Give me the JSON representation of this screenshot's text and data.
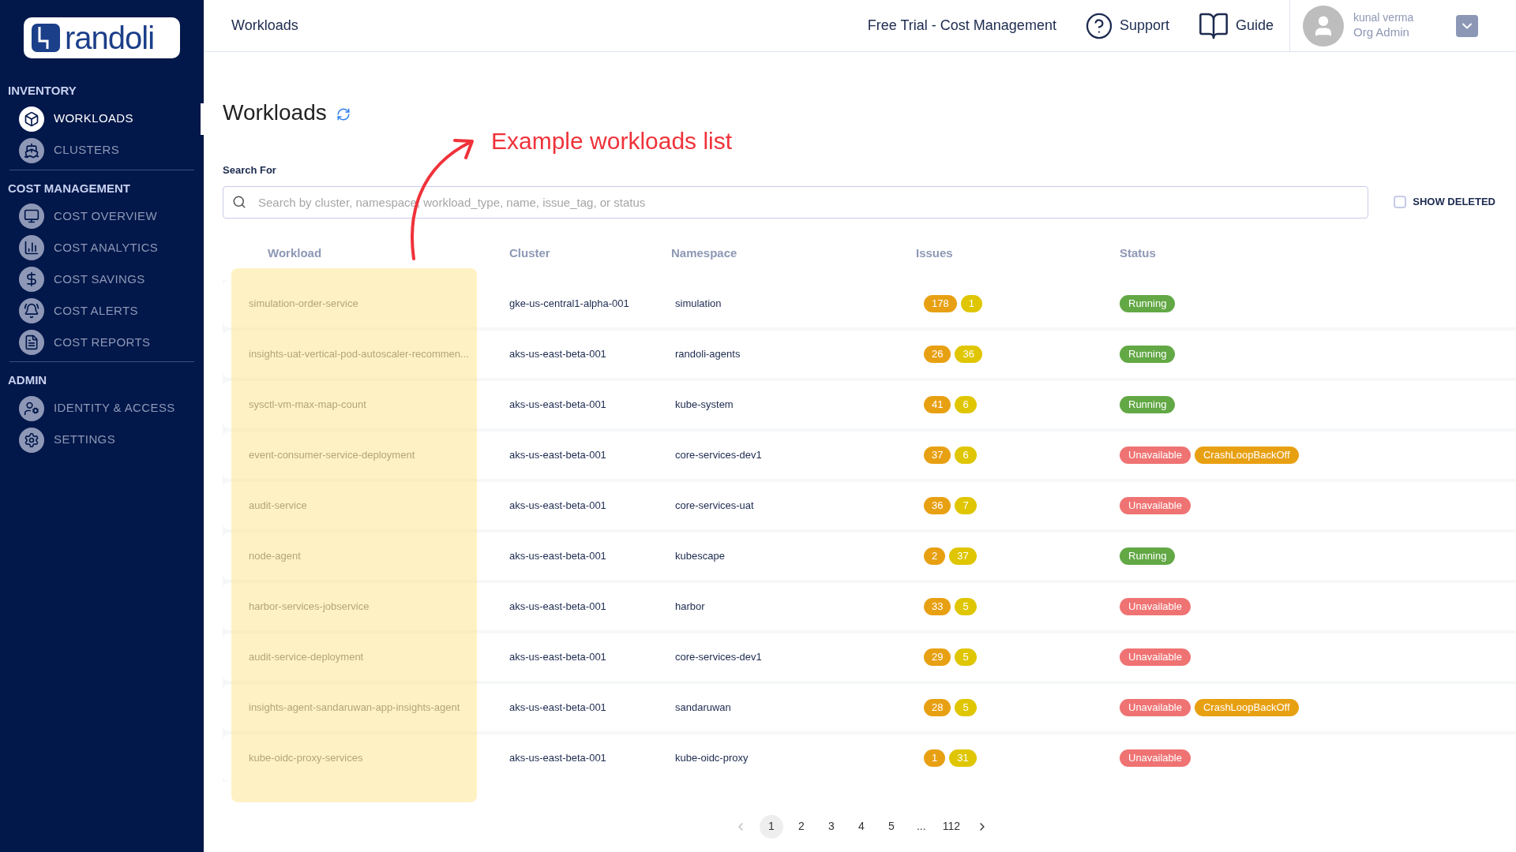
{
  "logo": {
    "text": "randoli"
  },
  "sidebar": {
    "sections": [
      {
        "title": "INVENTORY",
        "items": [
          {
            "label": "WORKLOADS",
            "kind": "cube",
            "selected": true
          },
          {
            "label": "CLUSTERS",
            "kind": "helm",
            "selected": false
          }
        ]
      },
      {
        "title": "COST MANAGEMENT",
        "items": [
          {
            "label": "COST OVERVIEW",
            "kind": "monitor",
            "selected": false
          },
          {
            "label": "COST ANALYTICS",
            "kind": "chart",
            "selected": false
          },
          {
            "label": "COST SAVINGS",
            "kind": "bag",
            "selected": false
          },
          {
            "label": "COST ALERTS",
            "kind": "bell",
            "selected": false
          },
          {
            "label": "COST REPORTS",
            "kind": "report",
            "selected": false
          }
        ]
      },
      {
        "title": "ADMIN",
        "items": [
          {
            "label": "IDENTITY & ACCESS",
            "kind": "user",
            "selected": false
          },
          {
            "label": "SETTINGS",
            "kind": "gear",
            "selected": false
          }
        ]
      }
    ]
  },
  "header": {
    "breadcrumb": "Workloads",
    "trial": "Free Trial - Cost Management",
    "support": "Support",
    "guide": "Guide",
    "user": {
      "name": "kunal verma",
      "role": "Org Admin"
    }
  },
  "page": {
    "title": "Workloads",
    "annotation": "Example workloads list",
    "search_label": "Search For",
    "search": {
      "placeholder": "Search by cluster, namespace, workload_type, name, issue_tag, or status"
    },
    "show_deleted": {
      "label": "SHOW DELETED",
      "checked": false
    }
  },
  "table": {
    "columns": [
      "Workload",
      "Cluster",
      "Namespace",
      "Issues",
      "Status"
    ],
    "rows": [
      {
        "workload": "simulation-order-service",
        "cluster": "gke-us-central1-alpha-001",
        "namespace": "simulation",
        "issues": [
          {
            "count": "178",
            "kind": "high"
          },
          {
            "count": "1",
            "kind": "medium"
          }
        ],
        "status": [
          {
            "label": "Running",
            "kind": "running"
          }
        ]
      },
      {
        "workload": "insights-uat-vertical-pod-autoscaler-recommen...",
        "cluster": "aks-us-east-beta-001",
        "namespace": "randoli-agents",
        "issues": [
          {
            "count": "26",
            "kind": "high"
          },
          {
            "count": "36",
            "kind": "medium"
          }
        ],
        "status": [
          {
            "label": "Running",
            "kind": "running"
          }
        ]
      },
      {
        "workload": "sysctl-vm-max-map-count",
        "cluster": "aks-us-east-beta-001",
        "namespace": "kube-system",
        "issues": [
          {
            "count": "41",
            "kind": "high"
          },
          {
            "count": "6",
            "kind": "medium"
          }
        ],
        "status": [
          {
            "label": "Running",
            "kind": "running"
          }
        ]
      },
      {
        "workload": "event-consumer-service-deployment",
        "cluster": "aks-us-east-beta-001",
        "namespace": "core-services-dev1",
        "issues": [
          {
            "count": "37",
            "kind": "high"
          },
          {
            "count": "6",
            "kind": "medium"
          }
        ],
        "status": [
          {
            "label": "Unavailable",
            "kind": "unavailable"
          },
          {
            "label": "CrashLoopBackOff",
            "kind": "warning"
          }
        ]
      },
      {
        "workload": "audit-service",
        "cluster": "aks-us-east-beta-001",
        "namespace": "core-services-uat",
        "issues": [
          {
            "count": "36",
            "kind": "high"
          },
          {
            "count": "7",
            "kind": "medium"
          }
        ],
        "status": [
          {
            "label": "Unavailable",
            "kind": "unavailable"
          }
        ]
      },
      {
        "workload": "node-agent",
        "cluster": "aks-us-east-beta-001",
        "namespace": "kubescape",
        "issues": [
          {
            "count": "2",
            "kind": "high"
          },
          {
            "count": "37",
            "kind": "medium"
          }
        ],
        "status": [
          {
            "label": "Running",
            "kind": "running"
          }
        ]
      },
      {
        "workload": "harbor-services-jobservice",
        "cluster": "aks-us-east-beta-001",
        "namespace": "harbor",
        "issues": [
          {
            "count": "33",
            "kind": "high"
          },
          {
            "count": "5",
            "kind": "medium"
          }
        ],
        "status": [
          {
            "label": "Unavailable",
            "kind": "unavailable"
          }
        ]
      },
      {
        "workload": "audit-service-deployment",
        "cluster": "aks-us-east-beta-001",
        "namespace": "core-services-dev1",
        "issues": [
          {
            "count": "29",
            "kind": "high"
          },
          {
            "count": "5",
            "kind": "medium"
          }
        ],
        "status": [
          {
            "label": "Unavailable",
            "kind": "unavailable"
          }
        ]
      },
      {
        "workload": "insights-agent-sandaruwan-app-insights-agent",
        "cluster": "aks-us-east-beta-001",
        "namespace": "sandaruwan",
        "issues": [
          {
            "count": "28",
            "kind": "high"
          },
          {
            "count": "5",
            "kind": "medium"
          }
        ],
        "status": [
          {
            "label": "Unavailable",
            "kind": "unavailable"
          },
          {
            "label": "CrashLoopBackOff",
            "kind": "warning"
          }
        ]
      },
      {
        "workload": "kube-oidc-proxy-services",
        "cluster": "aks-us-east-beta-001",
        "namespace": "kube-oidc-proxy",
        "issues": [
          {
            "count": "1",
            "kind": "high"
          },
          {
            "count": "31",
            "kind": "medium"
          }
        ],
        "status": [
          {
            "label": "Unavailable",
            "kind": "unavailable"
          }
        ]
      }
    ]
  },
  "pagination": {
    "pages": [
      {
        "label": "1",
        "selected": true
      },
      {
        "label": "2",
        "selected": false
      },
      {
        "label": "3",
        "selected": false
      },
      {
        "label": "4",
        "selected": false
      },
      {
        "label": "5",
        "selected": false
      },
      {
        "label": "...",
        "selected": false
      },
      {
        "label": "112",
        "selected": false
      }
    ]
  }
}
